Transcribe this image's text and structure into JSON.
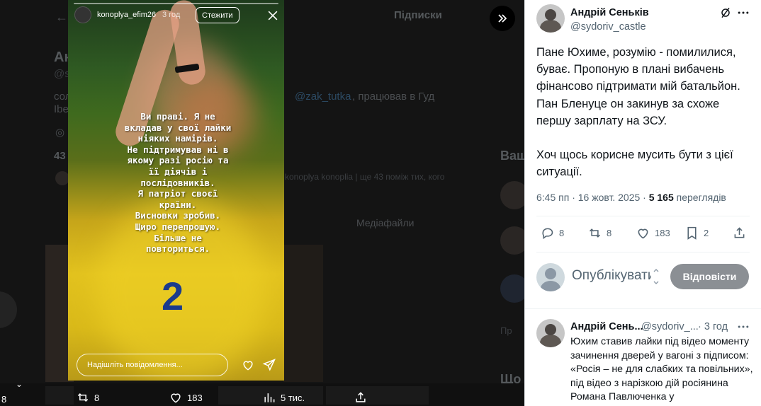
{
  "background": {
    "tab_label": "Підписки",
    "profile_name_fragment": "Ан",
    "handle_fragment": "@s",
    "bio_fragment_1": "сол",
    "bio_mention": "@zak_tutka",
    "bio_fragment_2": ", працював в Гуд",
    "bio_fragment_3": "Ibe",
    "followers_fragment": "43",
    "followed_by_text": "konoplya konoplia | ще 43 поміж тих, кого",
    "media_tab": "Медіафайли",
    "side_text_1": "Ваш",
    "side_text_2": "Що",
    "side_text_3": "Пр",
    "left_count": "8",
    "actions": {
      "retweets": "8",
      "likes": "183",
      "views": "5 тис."
    }
  },
  "story": {
    "username": "konoplya_efim26",
    "time": "3 год",
    "follow_label": "Стежити",
    "caption_lines": [
      "Ви праві. Я не",
      "вкладав у свої лайки",
      "ніяких намірів.",
      "Не підтримував ні в",
      "якому разі росію та",
      "її діячів і",
      "послідовників.",
      "Я патріот своєї",
      "країни.",
      "Висновки зробив.",
      "Щиро перепрошую.",
      "Більше не",
      "повториться."
    ],
    "shirt_number": "2",
    "message_placeholder": "Надішліть повідомлення..."
  },
  "tweet": {
    "author_name": "Андрій Сеньків",
    "author_handle": "@sydoriv_castle",
    "body_paragraphs": [
      "Пане Юхиме, розумію - помилилися, буває. Пропоную в плані вибачень фінансово підтримати мій батальйон. Пан Бленуце он закинув за схоже першу зарплату на ЗСУ.",
      "Хоч щось корисне мусить бути з цієї ситуації."
    ],
    "timestamp": "6:45 пп · 16 жовт. 2025 ·",
    "views_count": "5 165",
    "views_label": "переглядів",
    "replies": "8",
    "retweets": "8",
    "likes": "183",
    "bookmarks": "2",
    "reply_placeholder": "Опублікувати відповідь",
    "reply_button": "Відповісти"
  },
  "reply_tweet": {
    "author_name": "Андрій Сень...",
    "author_handle": "@sydoriv_...",
    "time": "· 3 год",
    "body": "Юхим ставив лайки під відео моменту зачинення дверей у вагоні з підписом: «Росія – не для слабких та повільних», під відео з нарізкою дій росіянина Романа Павлюченка у"
  }
}
